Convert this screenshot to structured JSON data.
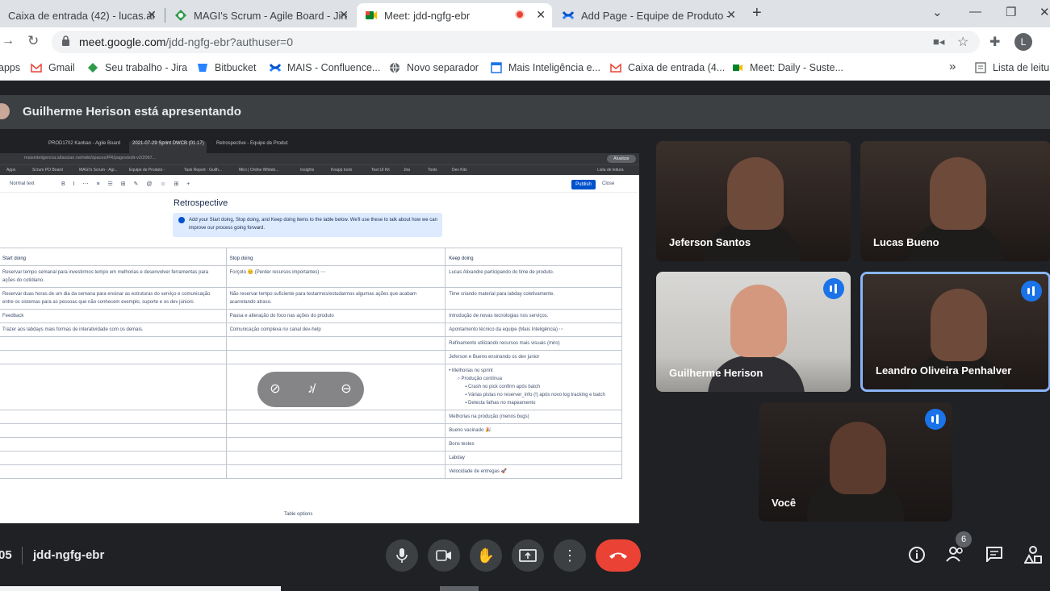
{
  "browser": {
    "tabs": [
      {
        "title": "Caixa de entrada (42) - lucas.alix",
        "icon": "gmail-icon"
      },
      {
        "title": "MAGI's Scrum - Agile Board - Jira",
        "icon": "jira-icon"
      },
      {
        "title": "Meet: jdd-ngfg-ebr",
        "icon": "meet-icon",
        "active": true
      },
      {
        "title": "Add Page - Equipe de Produto -",
        "icon": "confluence-icon"
      }
    ],
    "url_host": "meet.google.com",
    "url_path": "/jdd-ngfg-ebr?authuser=0",
    "profile_initial": "L",
    "bookmarks": [
      {
        "label": "apps"
      },
      {
        "label": "Gmail"
      },
      {
        "label": "Seu trabalho - Jira"
      },
      {
        "label": "Bitbucket"
      },
      {
        "label": "MAIS - Confluence..."
      },
      {
        "label": "Novo separador"
      },
      {
        "label": "Mais Inteligência e..."
      },
      {
        "label": "Caixa de entrada (4..."
      },
      {
        "label": "Meet: Daily - Suste..."
      },
      {
        "label": "Lista de leitur"
      }
    ],
    "overflow_label": "»"
  },
  "meet": {
    "presenter_text": "Guilherme Herison está apresentando",
    "shared": {
      "tabs": [
        "PROD1702 Kanban - Agile Board",
        "2021-07-29 Sprint DWCB (01.17)",
        "Retrospective - Equipe de Produt"
      ],
      "url": "maisinteligencia.atlassian.net/wiki/spaces/PR/pages/edit-v2/2097...",
      "profile_btn": "Atualizar",
      "bookmarks": [
        "Apps",
        "Scrum PO Board",
        "MAGI's Scrum - Agi...",
        "Equipe de Produto -",
        "Task Report - Guilh...",
        "Miro | Online Whiteb...",
        "Insights",
        "Knapp tools",
        "Test UI Kit",
        "Jira",
        "Tools",
        "Dev Kits",
        "Lista de leitura"
      ],
      "editor_style": "Normal text",
      "publish": "Publish",
      "close": "Close",
      "title": "Retrospective",
      "info_text": "Add your Start doing, Stop doing, and Keep doing items to the table below. We'll use these to talk about how we can improve our process going forward.",
      "headers": [
        "Start doing",
        "Stop doing",
        "Keep doing"
      ],
      "rows": [
        [
          "Reservar tempo semanal para investirmos tempo em melhorias e desenvolver ferramentas para ações do cotidiano.",
          "Forçoto 😊 (Perder recursos importantes) ⋯",
          "Lucas Alixandre participando do time de produto."
        ],
        [
          "Reservar duas horas de um dia da semana para ensinar as estruturas do serviço e comunicação entre os sistemas para as pessoas que não conhecem exemplo, suporte e os dev júniors",
          "Não reservar tempo suficiente para testarmos/estudarmos algumas ações que acabam acarretando atraso.",
          "Time criando material para labday coletivamente."
        ],
        [
          "Feedback",
          "Pausa e alteração do foco nas ações do produto",
          "Introdução de novas tecnologias nos serviços."
        ],
        [
          "Trazer aos labdays mais formas de interatividade com os demais.",
          "Comunicação complexa no canal dev-help",
          "Apontamento técnico da equipe (Mais Inteligência) ⋯"
        ],
        [
          "",
          "",
          "Refinamento utilizando recursos mais visuais (miro)"
        ],
        [
          "",
          "",
          "Jeferson e Bueno ensinando os dev junior"
        ]
      ],
      "nested": {
        "l1": "Melhorias no sprint",
        "l2": "Produção contínua",
        "l3": [
          "Crash no pick confirm após batch",
          "Várias pistas no reserver_info (!) após novo log tracking e batch",
          "Detecta falhas no mapeamento"
        ]
      },
      "tail_rows": [
        "Melhorias na produção (menos bugs)",
        "Bueno vacinado 🎉",
        "Bons testes",
        "Labday",
        "Velocidade de entregas 🚀"
      ],
      "table_options": "Table options"
    },
    "participants": [
      {
        "name": "Jeferson Santos",
        "speaking": false,
        "mic": false
      },
      {
        "name": "Lucas Bueno",
        "speaking": false,
        "mic": false
      },
      {
        "name": "Guilherme Herison",
        "speaking": false,
        "mic": true
      },
      {
        "name": "Leandro Oliveira Penhalver",
        "speaking": true,
        "mic": true
      },
      {
        "name": "Você",
        "speaking": false,
        "mic": true
      }
    ],
    "time": "05",
    "meeting_code": "jdd-ngfg-ebr",
    "people_count": "6"
  }
}
